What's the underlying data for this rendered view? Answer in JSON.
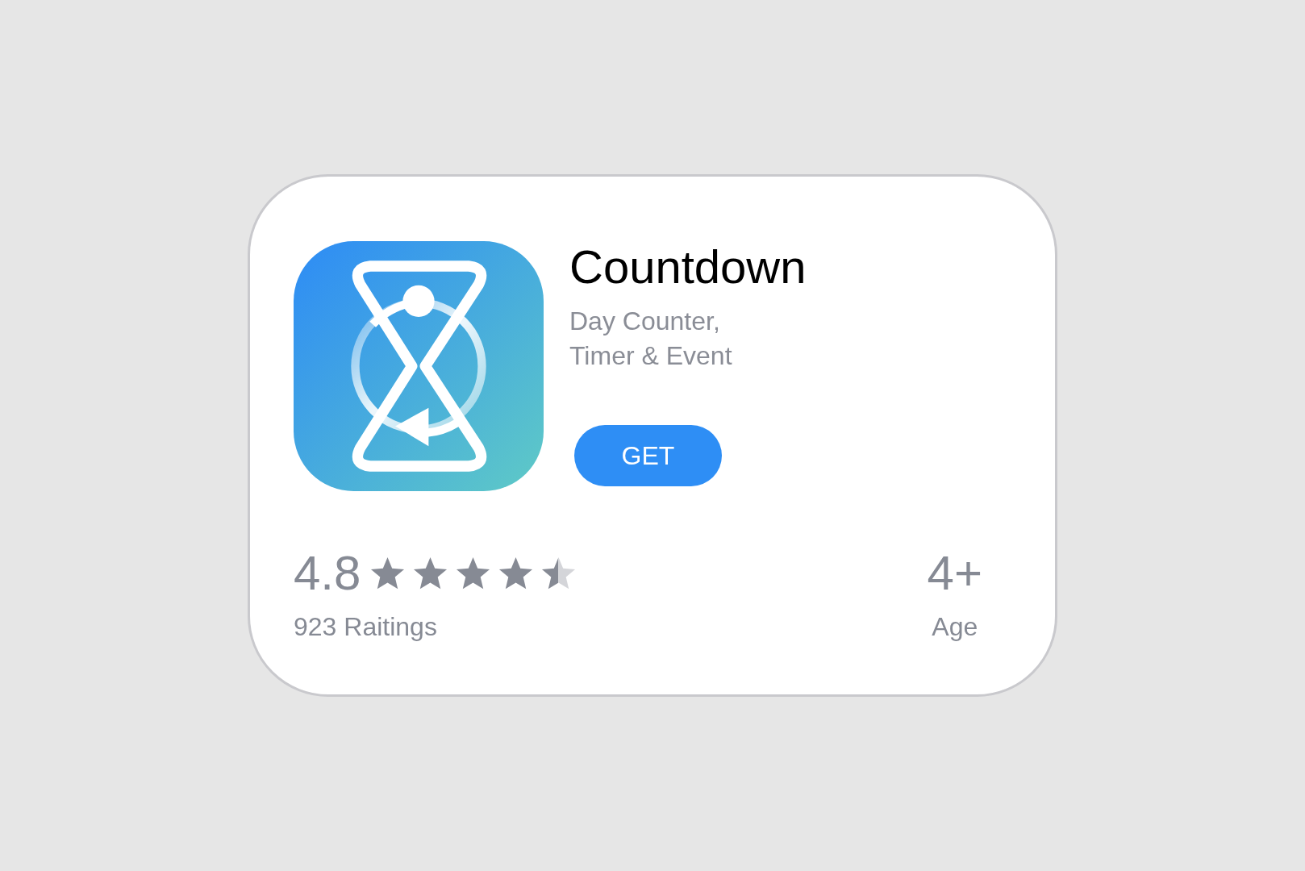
{
  "app": {
    "title": "Countdown",
    "subtitle_lines": [
      "Day Counter,",
      "Timer & Event"
    ],
    "button": "GET"
  },
  "rating": {
    "value": "4.8",
    "stars": 4.5,
    "count": "923 Raitings"
  },
  "age": {
    "value": "4+",
    "label": "Age"
  }
}
